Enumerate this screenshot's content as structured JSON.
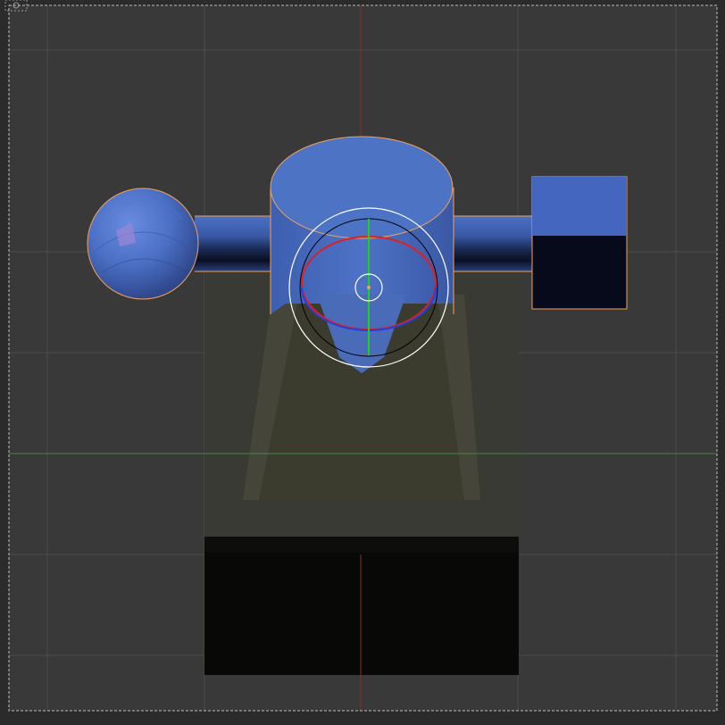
{
  "viewport": {
    "background": "#393939",
    "outer_frame": "#2b2b2b",
    "grid_color": "#4a4a4a",
    "frame_border": "#bfbfbf"
  },
  "axes": {
    "x_axis_color": "#3f8c3f",
    "y_axis_color": "#8c2a2a"
  },
  "objects": {
    "selected_outline": "#f2a15a",
    "mesh_color": "#4a6fc4",
    "ground_color": "#3a3a30",
    "shadow_color": "#080808"
  },
  "gizmo": {
    "type": "rotate",
    "x_ring_color": "#e02020",
    "y_ring_color": "#20d020",
    "z_ring_color": "#2040e0",
    "view_ring_color": "#ffffff",
    "trackball_color": "#000000"
  },
  "icons": {
    "corner": "camera-icon"
  }
}
